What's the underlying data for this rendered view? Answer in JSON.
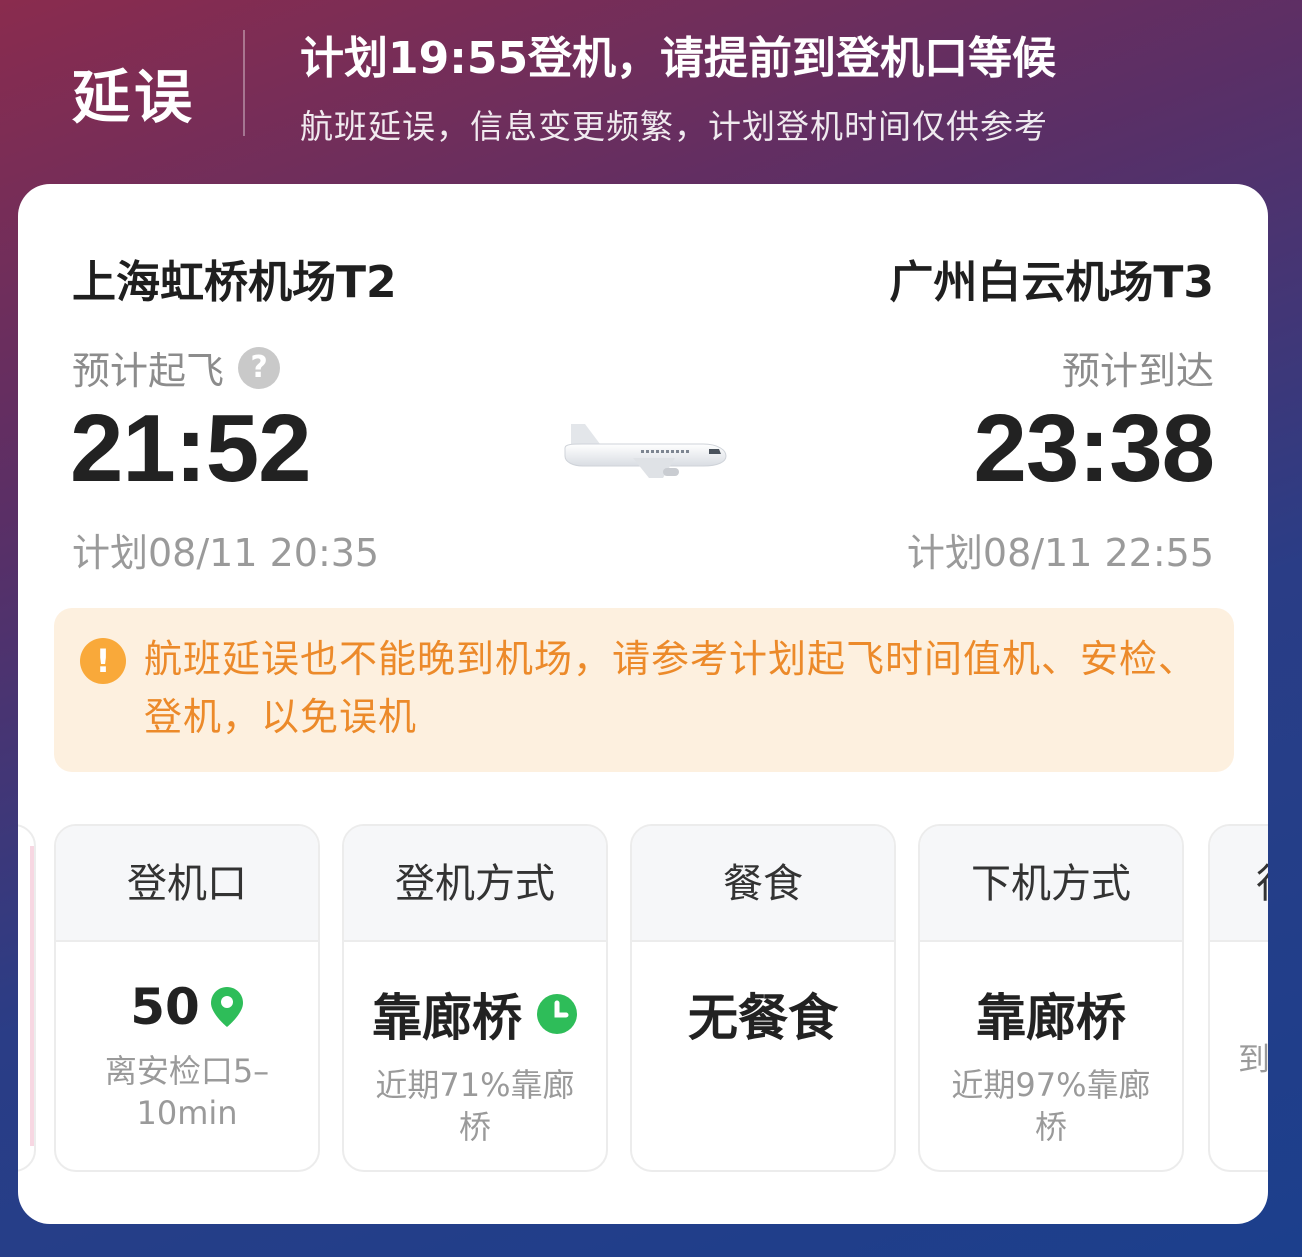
{
  "header": {
    "status": "延误",
    "title": "计划19:55登机，请提前到登机口等候",
    "subtitle": "航班延误，信息变更频繁，计划登机时间仅供参考"
  },
  "departure": {
    "airport": "上海虹桥机场T2",
    "label": "预计起飞",
    "time": "21:52",
    "planned": "计划08/11 20:35",
    "help_icon": "question-circle-icon"
  },
  "arrival": {
    "airport": "广州白云机场T3",
    "label": "预计到达",
    "time": "23:38",
    "planned": "计划08/11 22:55"
  },
  "plane_icon": "airplane-icon",
  "notice": {
    "icon": "warning-icon",
    "text": "航班延误也不能晚到机场，请参考计划起飞时间值机、安检、登机，以免误机"
  },
  "tiles": [
    {
      "header": "登机口",
      "value": "50",
      "icon": "location-pin-icon",
      "sub": "离安检口5–10min"
    },
    {
      "header": "登机方式",
      "value": "靠廊桥",
      "icon": "clock-icon",
      "sub": "近期71%靠廊桥"
    },
    {
      "header": "餐食",
      "value": "无餐食",
      "sub": ""
    },
    {
      "header": "下机方式",
      "value": "靠廊桥",
      "sub": "近期97%靠廊桥"
    },
    {
      "header": "行",
      "sub": "到"
    }
  ],
  "colors": {
    "accent_orange": "#ec8a2a",
    "warning_bg": "#fdf0df",
    "pin_green": "#2ebd59"
  }
}
